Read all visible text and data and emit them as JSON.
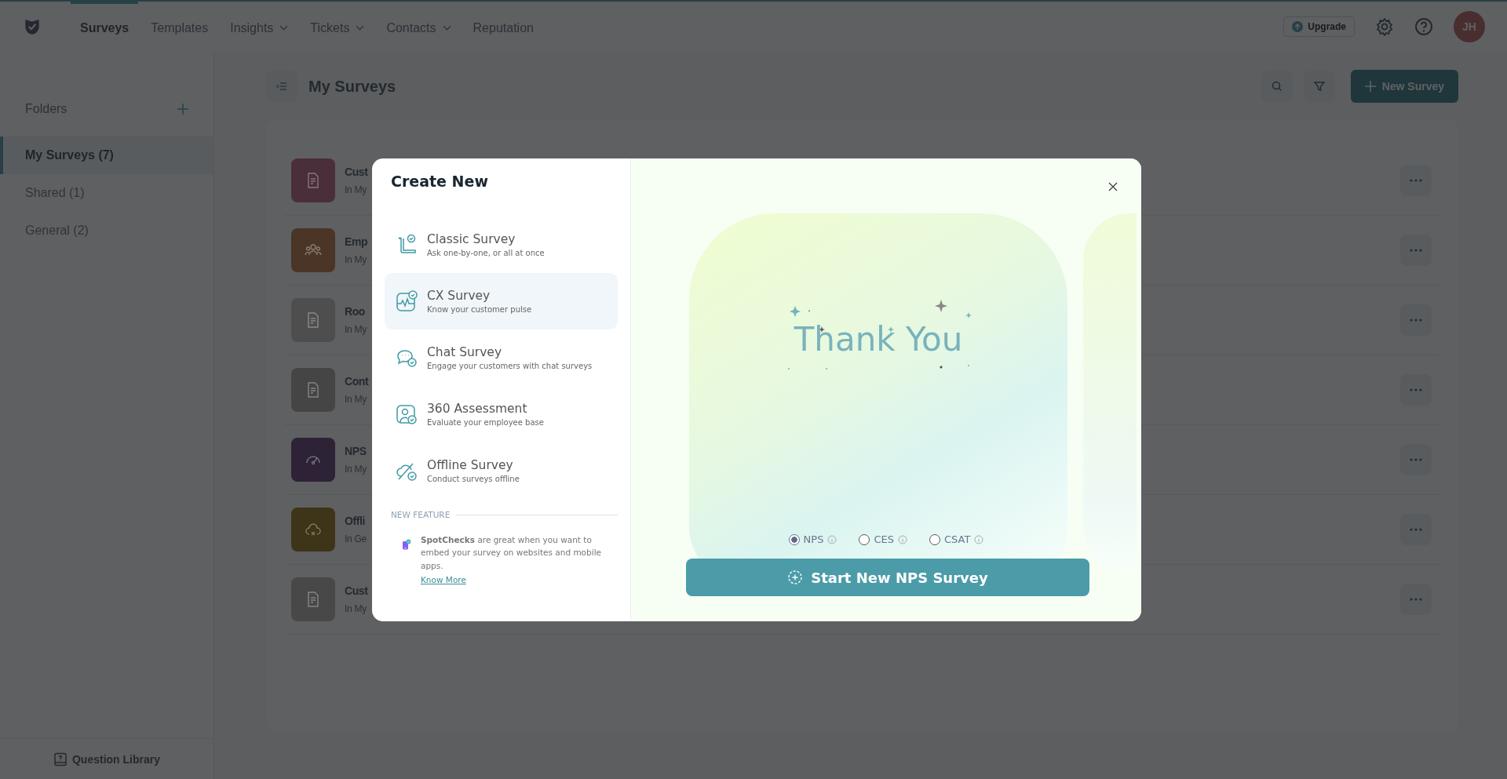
{
  "nav": {
    "tabs": [
      {
        "label": "Surveys",
        "selected": true,
        "dropdown": false
      },
      {
        "label": "Templates",
        "selected": false,
        "dropdown": false
      },
      {
        "label": "Insights",
        "selected": false,
        "dropdown": true
      },
      {
        "label": "Tickets",
        "selected": false,
        "dropdown": true
      },
      {
        "label": "Contacts",
        "selected": false,
        "dropdown": true
      },
      {
        "label": "Reputation",
        "selected": false,
        "dropdown": false
      }
    ],
    "upgrade": "Upgrade",
    "avatar": "JH"
  },
  "sidebar": {
    "title": "Folders",
    "items": [
      {
        "label": "My Surveys (7)",
        "selected": true
      },
      {
        "label": "Shared (1)",
        "selected": false
      },
      {
        "label": "General (2)",
        "selected": false
      }
    ],
    "footer": "Question Library"
  },
  "header": {
    "title": "My Surveys",
    "new_button": "New Survey"
  },
  "surveys": [
    {
      "title": "Cust",
      "subtitle": "In My",
      "color": "#4a2f3a",
      "kind": "document"
    },
    {
      "title": "Emp",
      "subtitle": "In My",
      "color": "#4a3526",
      "kind": "people"
    },
    {
      "title": "Roo",
      "subtitle": "In My",
      "color": "#4e4e4e",
      "kind": "document"
    },
    {
      "title": "Cont",
      "subtitle": "In My",
      "color": "#454545",
      "kind": "document"
    },
    {
      "title": "NPS",
      "subtitle": "In My",
      "color": "#2e2236",
      "kind": "gauge"
    },
    {
      "title": "Offli",
      "subtitle": "In Ge",
      "color": "#3e3418",
      "kind": "cloud"
    },
    {
      "title": "Cust",
      "subtitle": "In My",
      "color": "#484848",
      "kind": "document"
    }
  ],
  "modal": {
    "title": "Create New",
    "options": [
      {
        "title": "Classic Survey",
        "description": "Ask one-by-one, or all at once",
        "kind": "scroll",
        "selected": false
      },
      {
        "title": "CX Survey",
        "description": "Know your customer pulse",
        "kind": "pulse",
        "selected": true
      },
      {
        "title": "Chat Survey",
        "description": "Engage your customers with chat surveys",
        "kind": "chat",
        "selected": false
      },
      {
        "title": "360 Assessment",
        "description": "Evaluate your employee base",
        "kind": "person",
        "selected": false
      },
      {
        "title": "Offline Survey",
        "description": "Conduct surveys offline",
        "kind": "offline",
        "selected": false
      }
    ],
    "new_feature": "NEW FEATURE",
    "spotchecks": "**SpotChecks** are great when you want to embed your survey on websites and mobile apps.",
    "link": "Know More",
    "preview_text": "Thank You",
    "metrics": [
      {
        "label": "NPS",
        "selected": true
      },
      {
        "label": "CES",
        "selected": false
      },
      {
        "label": "CSAT",
        "selected": false
      }
    ],
    "start_button": "Start New NPS Survey"
  }
}
